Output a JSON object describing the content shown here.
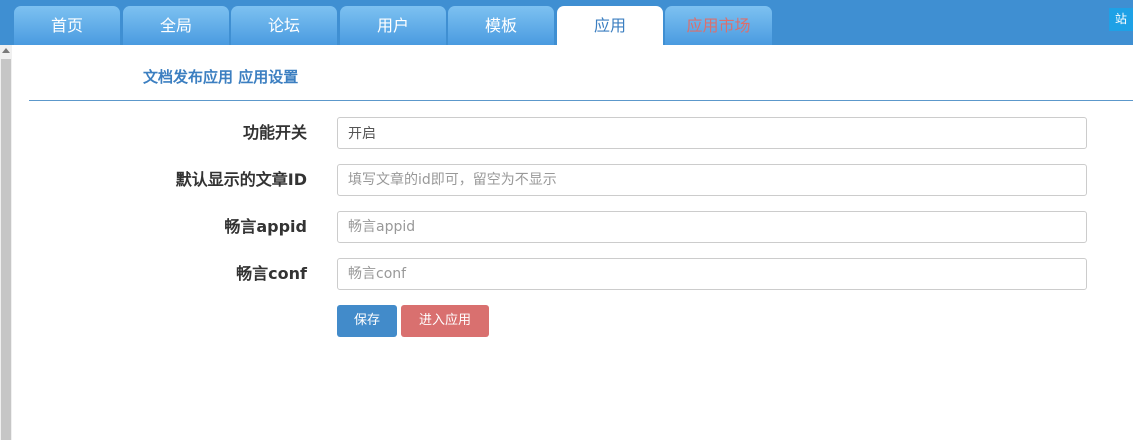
{
  "nav": {
    "tabs": [
      {
        "label": "首页"
      },
      {
        "label": "全局"
      },
      {
        "label": "论坛"
      },
      {
        "label": "用户"
      },
      {
        "label": "模板"
      },
      {
        "label": "应用"
      },
      {
        "label": "应用市场"
      }
    ],
    "active_tab": "应用",
    "corner_button": "站"
  },
  "page": {
    "title": "文档发布应用 应用设置"
  },
  "form": {
    "fields": [
      {
        "label": "功能开关",
        "value": "开启",
        "placeholder": ""
      },
      {
        "label": "默认显示的文章ID",
        "value": "",
        "placeholder": "填写文章的id即可，留空为不显示"
      },
      {
        "label": "畅言appid",
        "value": "",
        "placeholder": "畅言appid"
      },
      {
        "label": "畅言conf",
        "value": "",
        "placeholder": "畅言conf"
      }
    ],
    "save_label": "保存",
    "enter_app_label": "进入应用"
  },
  "colors": {
    "nav_background": "#3f8fd2",
    "accent": "#3c7fc1",
    "primary_button": "#428bca",
    "danger_button": "#d9706f"
  }
}
